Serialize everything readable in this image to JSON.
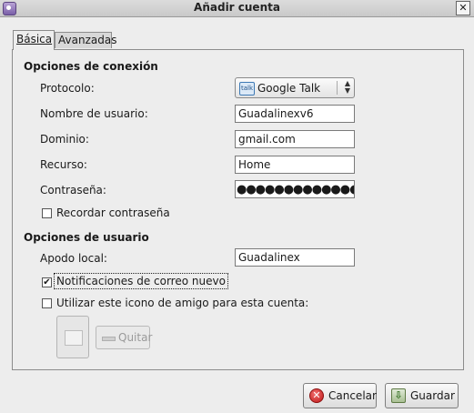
{
  "window": {
    "title": "Añadir cuenta"
  },
  "tabs": [
    {
      "label": "Básica",
      "mnemonic_index": 0
    },
    {
      "label": "Avanzadas",
      "mnemonic_index": 0
    }
  ],
  "connection": {
    "heading": "Opciones de conexión",
    "protocol": {
      "label": "Protocolo:",
      "value": "Google Talk",
      "icon": "google-talk-icon"
    },
    "username": {
      "label": "Nombre de usuario:",
      "value": "Guadalinexv6"
    },
    "domain": {
      "label": "Dominio:",
      "value": "gmail.com"
    },
    "resource": {
      "label": "Recurso:",
      "value": "Home"
    },
    "password": {
      "label": "Contraseña:",
      "value": "●●●●●●●●●●●●●"
    },
    "remember": {
      "label": "Recordar contraseña",
      "checked": false
    }
  },
  "user": {
    "heading": "Opciones de usuario",
    "alias": {
      "label": "Apodo local:",
      "value": "Guadalinex"
    },
    "mail_notifications": {
      "label": "Notificaciones de correo nuevo",
      "checked": true
    },
    "buddy_icon": {
      "label": "Utilizar este icono de amigo para esta cuenta:",
      "checked": false
    },
    "remove_label": "Quitar"
  },
  "buttons": {
    "cancel": "Cancelar",
    "save": "Guardar"
  },
  "colors": {
    "background": "#ededed",
    "border": "#8c8c8c",
    "entry_bg": "#ffffff"
  }
}
